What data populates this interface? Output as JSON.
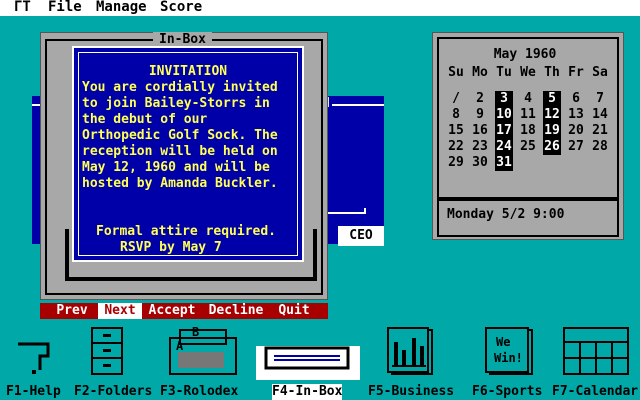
{
  "menubar": {
    "logo": "ГT",
    "items": [
      "File",
      "Manage",
      "Score"
    ]
  },
  "background_window": {
    "partial_title": "d",
    "button": "CEO"
  },
  "inbox": {
    "title": "In-Box",
    "message": {
      "heading": "INVITATION",
      "body": [
        "You are cordially invited",
        "to join Bailey-Storrs in",
        "the debut of our",
        "Orthopedic Golf Sock. The",
        "reception will be held on",
        "May 12, 1960 and will be",
        "hosted by Amanda Buckler."
      ],
      "footer": [
        "Formal attire required.",
        "RSVP by May 7"
      ]
    },
    "actions": [
      "Prev",
      "Next",
      "Accept",
      "Decline",
      "Quit"
    ],
    "selected_action": "Next"
  },
  "calendar": {
    "month": "May 1960",
    "weekdays": [
      "Su",
      "Mo",
      "Tu",
      "We",
      "Th",
      "Fr",
      "Sa"
    ],
    "weeks": [
      [
        "/",
        "2",
        "3",
        "4",
        "5",
        "6",
        "7"
      ],
      [
        "8",
        "9",
        "10",
        "11",
        "12",
        "13",
        "14"
      ],
      [
        "15",
        "16",
        "17",
        "18",
        "19",
        "20",
        "21"
      ],
      [
        "22",
        "23",
        "24",
        "25",
        "26",
        "27",
        "28"
      ],
      [
        "29",
        "30",
        "31",
        "",
        "",
        "",
        ""
      ]
    ],
    "highlighted_days": [
      "3",
      "5",
      "10",
      "12",
      "17",
      "19",
      "24",
      "26",
      "31"
    ],
    "status": "Monday 5/2 9:00"
  },
  "function_keys": [
    {
      "label": "F1-Help",
      "icon": "help-icon"
    },
    {
      "label": "F2-Folders",
      "icon": "filing-cabinet-icon"
    },
    {
      "label": "F3-Rolodex",
      "icon": "rolodex-icon",
      "tab_letters": [
        "B",
        "A"
      ]
    },
    {
      "label": "F4-In-Box",
      "icon": "inbox-tray-icon",
      "selected": true
    },
    {
      "label": "F5-Business",
      "icon": "business-chart-icon"
    },
    {
      "label": "F6-Sports",
      "icon": "sports-news-icon",
      "text": [
        "We",
        "Win!"
      ]
    },
    {
      "label": "F7-Calendar",
      "icon": "calendar-grid-icon"
    }
  ]
}
